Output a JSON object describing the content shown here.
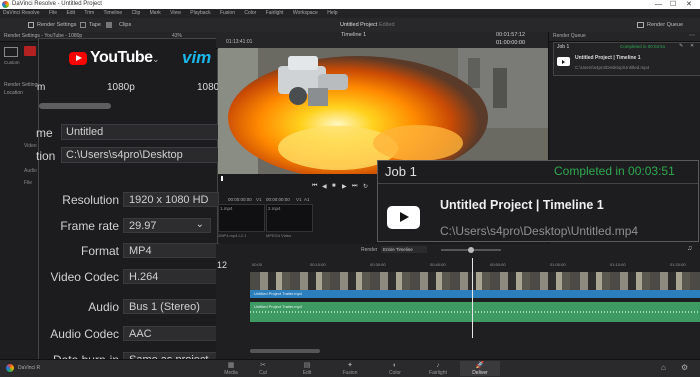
{
  "window": {
    "title": "DaVinci Resolve - Untitled Project",
    "minimize": "—",
    "maximize": "☐",
    "close": "✕"
  },
  "menu": [
    "DaVinci Resolve",
    "File",
    "Edit",
    "Trim",
    "Timeline",
    "Clip",
    "Mark",
    "View",
    "Playback",
    "Fusion",
    "Color",
    "Fairlight",
    "Workspace",
    "Help"
  ],
  "toolbar": {
    "render_settings": "Render Settings",
    "tape": "Tape",
    "clips": "Clips",
    "project_name": "Untitled Project",
    "project_status": "Edited",
    "render_queue": "Render Queue"
  },
  "left_panel": {
    "header": "Render Settings - YouTube - 1080p",
    "zoom": "43%",
    "custom": "Custom",
    "youtube": "YouTube",
    "vimeo": "vim",
    "res_mid": "1080p",
    "res_right": "1080",
    "res_left": "m",
    "name_label": "me",
    "name_value": "Untitled",
    "location_label": "tion",
    "location_value": "C:\\Users\\s4pro\\Desktop",
    "bg_render_settings": "Render Settings",
    "bg_location": "Location",
    "bg_video": "Video",
    "bg_audio": "Audio",
    "bg_file": "File"
  },
  "settings_rows": [
    {
      "label": "Resolution",
      "value": "1920 x 1080 HD"
    },
    {
      "label": "Frame rate",
      "value": "29.97"
    },
    {
      "label": "Format",
      "value": "MP4"
    },
    {
      "label": "Video Codec",
      "value": "H.264"
    },
    {
      "label": "Audio",
      "value": "Bus 1 (Stereo)"
    },
    {
      "label": "Audio Codec",
      "value": "AAC"
    },
    {
      "label": "Data burn-in",
      "value": "Same as project"
    }
  ],
  "viewer": {
    "timecode_left": "01:13:41:01",
    "timeline_name": "Timeline 1",
    "timecode_right": "00:01:57:12",
    "timecode_current": "01:00:00:00",
    "tc_src_a": "00:00:00:00",
    "tc_src_b": "00:00:00:00",
    "tc_v1a": "V1",
    "tc_v1b": "V1",
    "tc_a1": "A1",
    "clip1": "1.mp4",
    "clip2": "2.mp4",
    "thumb_label_1": "2MP4.mp4 L2.1",
    "thumb_label_2": "MPEG4 Video"
  },
  "render_queue": {
    "header": "Render Queue",
    "job": "Job 1",
    "status": "Completed in 00:03:51",
    "title": "Untitled Project | Timeline 1",
    "path": "C:\\Users\\s4pro\\Desktop\\Untitled.mp4"
  },
  "popup": {
    "job": "Job 1",
    "status": "Completed in 00:03:51",
    "title": "Untitled Project | Timeline 1",
    "path": "C:\\Users\\s4pro\\Desktop\\Untitled.mp4"
  },
  "timeline": {
    "render_label": "Render",
    "render_option": "Entire Timeline",
    "current_tc": "12",
    "ruler": [
      "00:00",
      "00:10:00",
      "00:30:00",
      "00:40:00",
      "00:50:00",
      "01:00:00",
      "01:10:00",
      "01:20:00"
    ],
    "video_clip_label": "Untitled Project Trailer.mp4",
    "audio_clip_label": "Untitled Project Trailer.mp4"
  },
  "pages": [
    "Media",
    "Cut",
    "Edit",
    "Fusion",
    "Color",
    "Fairlight",
    "Deliver"
  ],
  "app_name": "DaVinci Resolve",
  "colors": {
    "accent_green": "#2fa84f",
    "video_track": "#2b7fbd",
    "audio_track": "#3e9a63",
    "youtube_red": "#ff0000",
    "vimeo_blue": "#1ab7ea"
  }
}
